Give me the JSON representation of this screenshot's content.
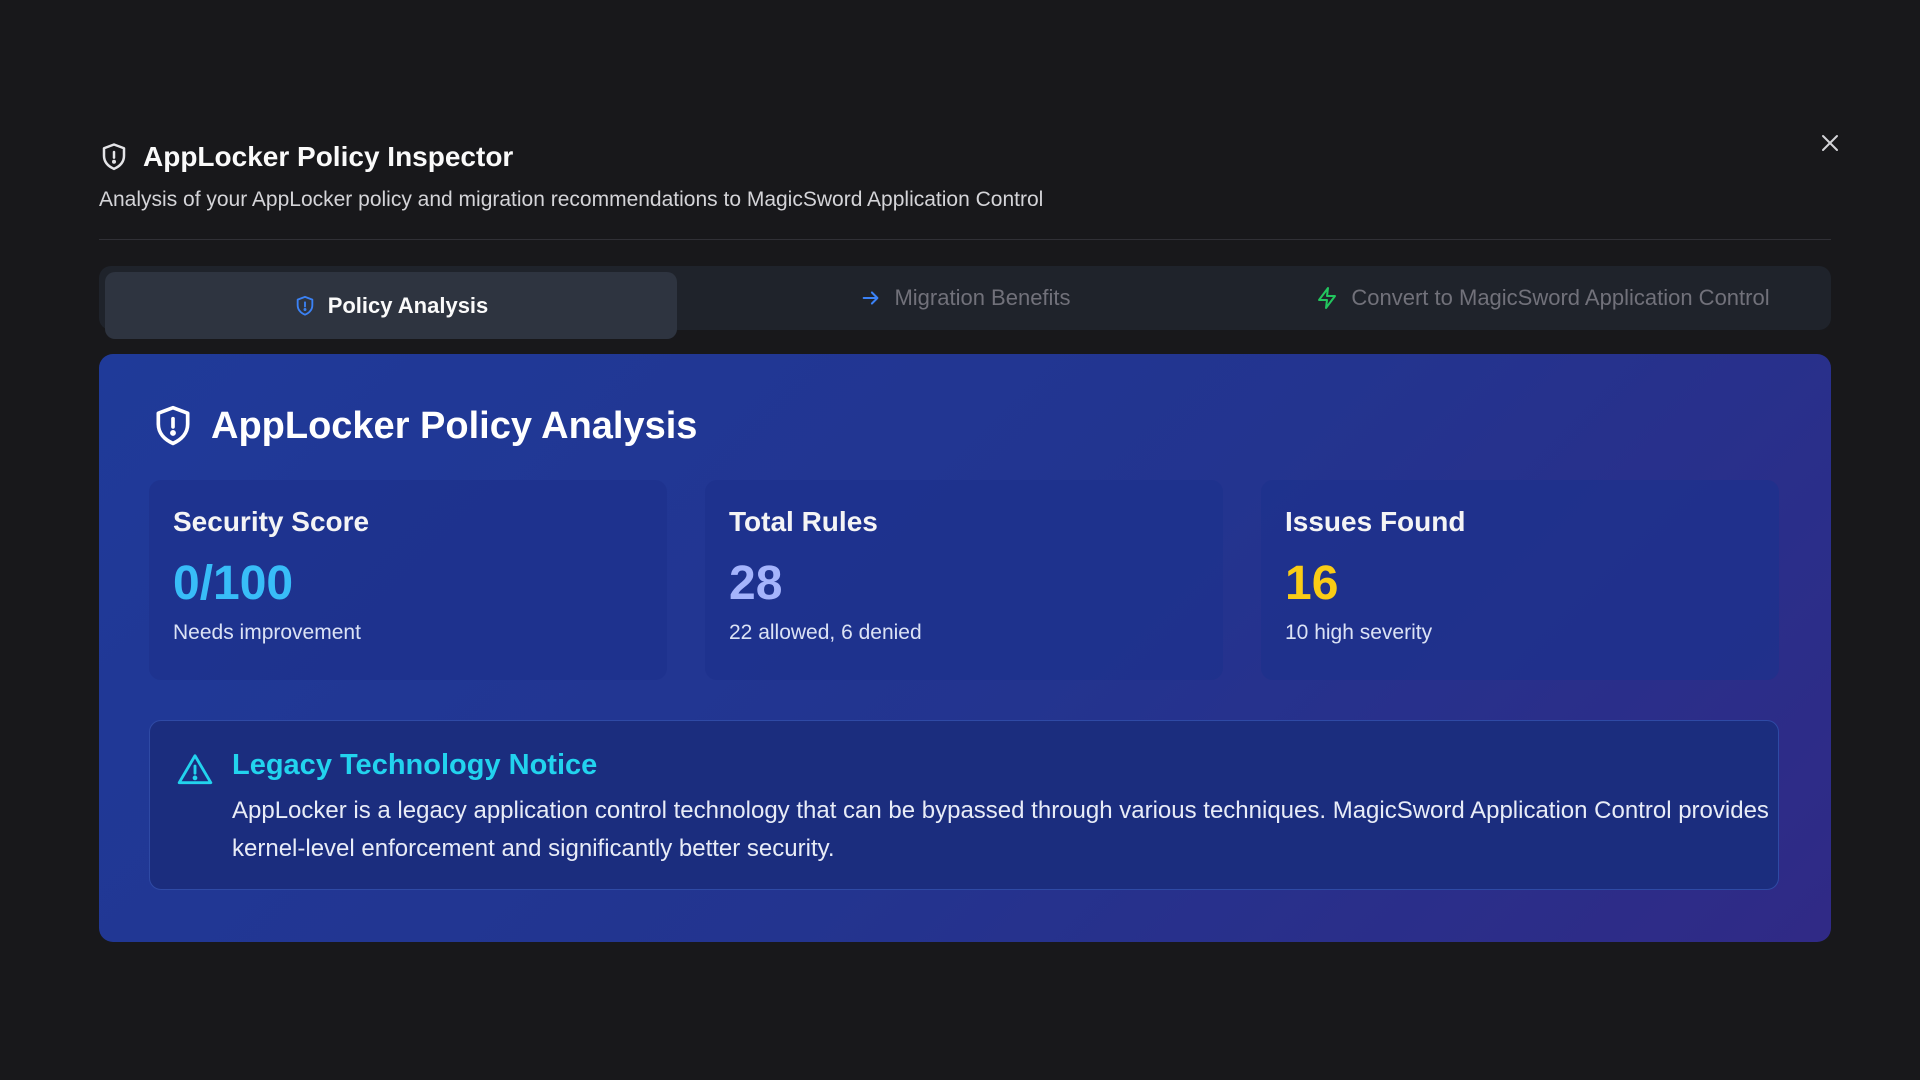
{
  "dialog": {
    "title": "AppLocker Policy Inspector",
    "subtitle": "Analysis of your AppLocker policy and migration recommendations to MagicSword Application Control",
    "close_icon": "close-icon"
  },
  "tabs": [
    {
      "label": "Policy Analysis",
      "icon": "shield-icon",
      "active": true
    },
    {
      "label": "Migration Benefits",
      "icon": "arrow-right-icon",
      "active": false
    },
    {
      "label": "Convert to MagicSword Application Control",
      "icon": "zap-icon",
      "active": false
    }
  ],
  "panel": {
    "title": "AppLocker Policy Analysis",
    "stats": [
      {
        "label": "Security Score",
        "value": "0/100",
        "note": "Needs improvement",
        "color": "#38bdf8"
      },
      {
        "label": "Total Rules",
        "value": "28",
        "note": "22 allowed, 6 denied",
        "color": "#a5b4fc"
      },
      {
        "label": "Issues Found",
        "value": "16",
        "note": "10 high severity",
        "color": "#facc15"
      }
    ],
    "notice": {
      "title": "Legacy Technology Notice",
      "text": "AppLocker is a legacy application control technology that can be bypassed through various techniques. MagicSword Application Control provides kernel-level enforcement and significantly better security."
    }
  },
  "colors": {
    "background": "#18181b",
    "panel_gradient_start": "#1f3a99",
    "panel_gradient_end": "#302a86",
    "accent_cyan": "#22d3ee",
    "tab_icon_blue": "#3b82f6",
    "tab_icon_green": "#22c55e"
  }
}
